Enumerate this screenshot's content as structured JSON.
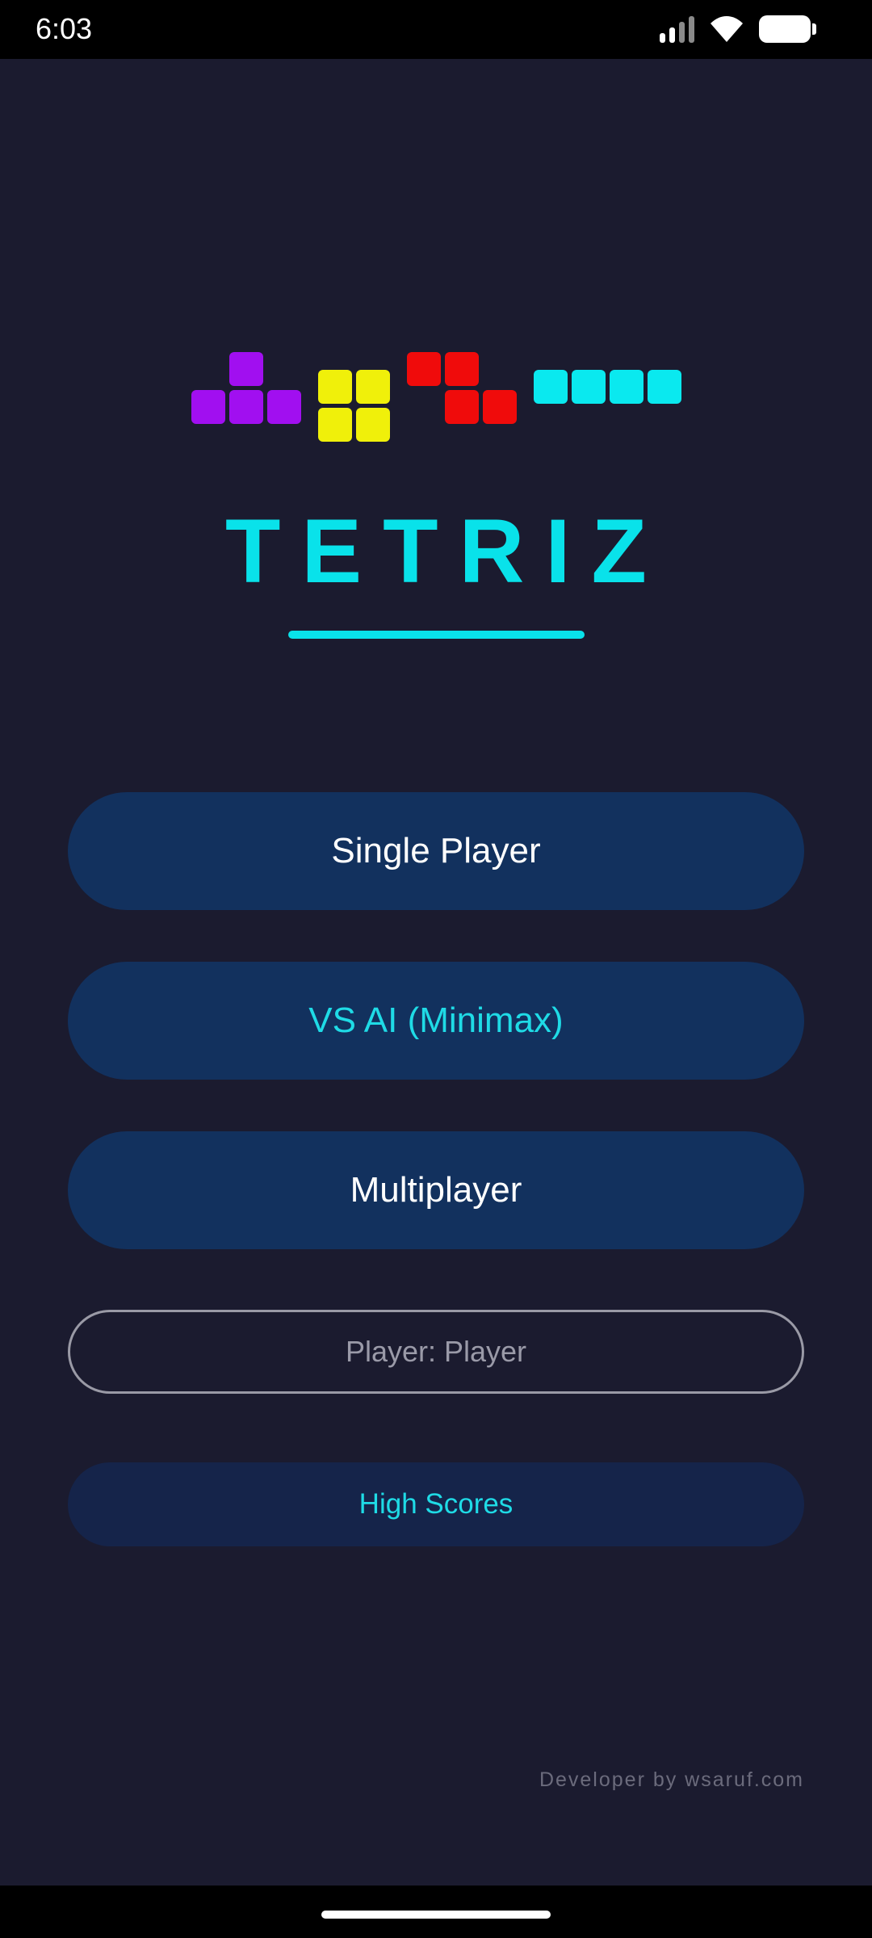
{
  "status_bar": {
    "time": "6:03",
    "icons": [
      "signal-icon",
      "wifi-icon",
      "battery-icon"
    ]
  },
  "logo": {
    "pieces": [
      "t-piece",
      "o-piece",
      "z-piece",
      "i-piece"
    ],
    "colors": {
      "purple": "#a10ff0",
      "yellow": "#f0f00a",
      "red": "#f00b0b",
      "cyan": "#0ae9ef"
    }
  },
  "title": "TETRIZ",
  "menu": {
    "single_player": "Single Player",
    "vs_ai": "VS AI (Minimax)",
    "multiplayer": "Multiplayer"
  },
  "player_field": {
    "value": "Player: Player"
  },
  "high_scores": "High Scores",
  "footer": {
    "developer": "Developer by wsaruf.com"
  },
  "theme": {
    "background": "#1b1b2f",
    "button": "#12315e",
    "accent": "#09e2ea"
  }
}
